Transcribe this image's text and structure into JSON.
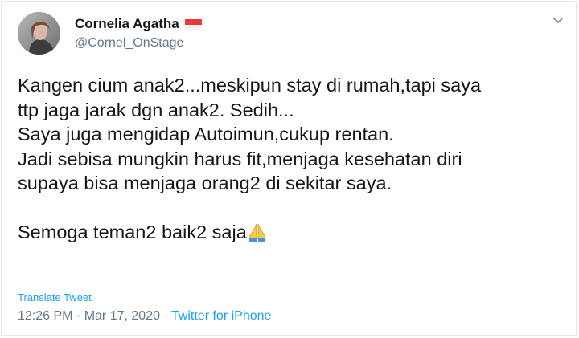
{
  "user": {
    "name": "Cornelia Agatha",
    "handle": "@Cornel_OnStage",
    "flag_icon": "indonesia-flag-icon"
  },
  "tweet": {
    "lines": [
      "Kangen cium anak2...meskipun stay di rumah,tapi saya",
      "ttp jaga jarak dgn anak2. Sedih...",
      "Saya juga mengidap Autoimun,cukup rentan.",
      "Jadi sebisa mungkin harus fit,menjaga kesehatan diri",
      "supaya bisa menjaga orang2 di sekitar saya.",
      "",
      "Semoga teman2 baik2 saja"
    ],
    "emoji": "folded-hands-icon",
    "translate_label": "Translate Tweet",
    "time": "12:26 PM",
    "date": "Mar 17, 2020",
    "separator": " · ",
    "source": "Twitter for iPhone"
  },
  "colors": {
    "link": "#1da1f2",
    "muted": "#657786",
    "text": "#14171a",
    "border": "#e1e8ed"
  }
}
